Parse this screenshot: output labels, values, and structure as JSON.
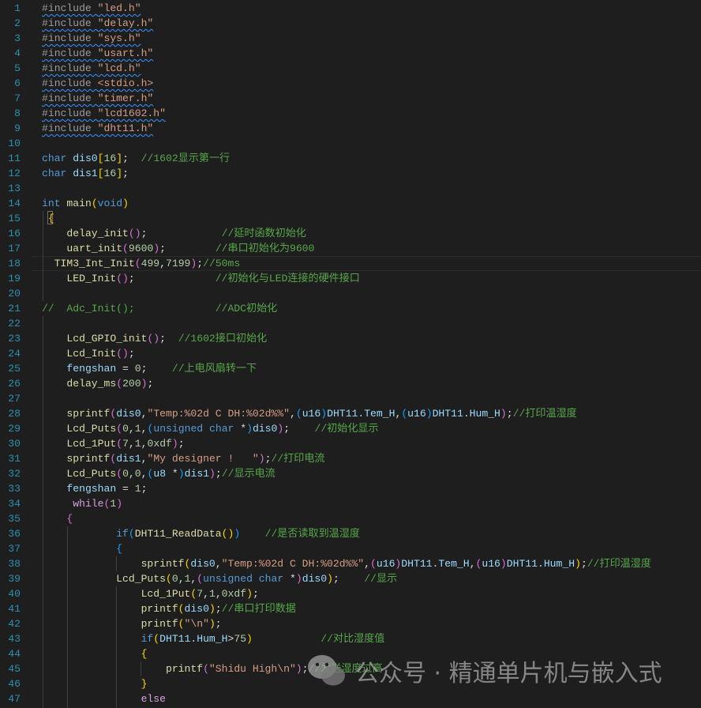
{
  "editor": {
    "lines": [
      {
        "n": "1",
        "sq": true,
        "tokens": [
          [
            "p",
            "#include "
          ],
          [
            "s",
            "\"led.h\""
          ]
        ]
      },
      {
        "n": "2",
        "sq": true,
        "tokens": [
          [
            "p",
            "#include "
          ],
          [
            "s",
            "\"delay.h\""
          ]
        ]
      },
      {
        "n": "3",
        "sq": true,
        "tokens": [
          [
            "p",
            "#include "
          ],
          [
            "s",
            "\"sys.h\""
          ]
        ]
      },
      {
        "n": "4",
        "sq": true,
        "tokens": [
          [
            "p",
            "#include "
          ],
          [
            "s",
            "\"usart.h\""
          ]
        ]
      },
      {
        "n": "5",
        "sq": true,
        "tokens": [
          [
            "p",
            "#include "
          ],
          [
            "s",
            "\"lcd.h\""
          ]
        ]
      },
      {
        "n": "6",
        "sq": true,
        "tokens": [
          [
            "p",
            "#include "
          ],
          [
            "s",
            "<stdio.h>"
          ]
        ]
      },
      {
        "n": "7",
        "sq": true,
        "tokens": [
          [
            "p",
            "#include "
          ],
          [
            "s",
            "\"timer.h\""
          ]
        ]
      },
      {
        "n": "8",
        "sq": true,
        "tokens": [
          [
            "p",
            "#include "
          ],
          [
            "s",
            "\"lcd1602.h\""
          ]
        ]
      },
      {
        "n": "9",
        "sq": true,
        "tokens": [
          [
            "p",
            "#include "
          ],
          [
            "s",
            "\"dht11.h\""
          ]
        ]
      },
      {
        "n": "10",
        "tokens": []
      },
      {
        "n": "11",
        "tokens": [
          [
            "k",
            "char"
          ],
          [
            "t",
            " "
          ],
          [
            "v",
            "dis0"
          ],
          [
            "b1",
            "["
          ],
          [
            "n",
            "16"
          ],
          [
            "b1",
            "]"
          ],
          [
            "t",
            ";  "
          ],
          [
            "m",
            "//1602显示第一行"
          ]
        ]
      },
      {
        "n": "12",
        "tokens": [
          [
            "k",
            "char"
          ],
          [
            "t",
            " "
          ],
          [
            "v",
            "dis1"
          ],
          [
            "b1",
            "["
          ],
          [
            "n",
            "16"
          ],
          [
            "b1",
            "]"
          ],
          [
            "t",
            ";"
          ]
        ]
      },
      {
        "n": "13",
        "tokens": []
      },
      {
        "n": "14",
        "tokens": [
          [
            "k",
            "int"
          ],
          [
            "t",
            " "
          ],
          [
            "f",
            "main"
          ],
          [
            "b1",
            "("
          ],
          [
            "k",
            "void"
          ],
          [
            "b1",
            ")"
          ]
        ]
      },
      {
        "n": "15",
        "tokens": [
          [
            "t",
            " "
          ],
          [
            "b1",
            "{"
          ]
        ]
      },
      {
        "n": "16",
        "tokens": [
          [
            "t",
            "    "
          ],
          [
            "f",
            "delay_init"
          ],
          [
            "b2",
            "()"
          ],
          [
            "t",
            ";            "
          ],
          [
            "m",
            "//延时函数初始化"
          ]
        ]
      },
      {
        "n": "17",
        "tokens": [
          [
            "t",
            "    "
          ],
          [
            "f",
            "uart_init"
          ],
          [
            "b2",
            "("
          ],
          [
            "n",
            "9600"
          ],
          [
            "b2",
            ")"
          ],
          [
            "t",
            ";        "
          ],
          [
            "m",
            "//串口初始化为9600"
          ]
        ]
      },
      {
        "n": "18",
        "tokens": [
          [
            "t",
            "  "
          ],
          [
            "f",
            "TIM3_Int_Init"
          ],
          [
            "b2",
            "("
          ],
          [
            "n",
            "499"
          ],
          [
            "t",
            ","
          ],
          [
            "n",
            "7199"
          ],
          [
            "b2",
            ")"
          ],
          [
            "t",
            ";"
          ],
          [
            "m",
            "//50ms"
          ]
        ]
      },
      {
        "n": "19",
        "tokens": [
          [
            "t",
            "    "
          ],
          [
            "f",
            "LED_Init"
          ],
          [
            "b2",
            "()"
          ],
          [
            "t",
            ";             "
          ],
          [
            "m",
            "//初始化与LED连接的硬件接口"
          ]
        ]
      },
      {
        "n": "20",
        "tokens": []
      },
      {
        "n": "21",
        "tokens": [
          [
            "m",
            "//  Adc_Init();             //ADC初始化"
          ]
        ]
      },
      {
        "n": "22",
        "tokens": []
      },
      {
        "n": "23",
        "tokens": [
          [
            "t",
            "    "
          ],
          [
            "f",
            "Lcd_GPIO_init"
          ],
          [
            "b2",
            "()"
          ],
          [
            "t",
            ";  "
          ],
          [
            "m",
            "//1602接口初始化"
          ]
        ]
      },
      {
        "n": "24",
        "tokens": [
          [
            "t",
            "    "
          ],
          [
            "f",
            "Lcd_Init"
          ],
          [
            "b2",
            "()"
          ],
          [
            "t",
            ";"
          ]
        ]
      },
      {
        "n": "25",
        "tokens": [
          [
            "t",
            "    "
          ],
          [
            "v",
            "fengshan"
          ],
          [
            "t",
            " = "
          ],
          [
            "n",
            "0"
          ],
          [
            "t",
            ";    "
          ],
          [
            "m",
            "//上电风扇转一下"
          ]
        ]
      },
      {
        "n": "26",
        "tokens": [
          [
            "t",
            "    "
          ],
          [
            "f",
            "delay_ms"
          ],
          [
            "b2",
            "("
          ],
          [
            "n",
            "200"
          ],
          [
            "b2",
            ")"
          ],
          [
            "t",
            ";"
          ]
        ]
      },
      {
        "n": "27",
        "tokens": []
      },
      {
        "n": "28",
        "tokens": [
          [
            "t",
            "    "
          ],
          [
            "f",
            "sprintf"
          ],
          [
            "b2",
            "("
          ],
          [
            "v",
            "dis0"
          ],
          [
            "t",
            ","
          ],
          [
            "s",
            "\"Temp:%02d C DH:%02d%%\""
          ],
          [
            "t",
            ","
          ],
          [
            "b3",
            "("
          ],
          [
            "v",
            "u16"
          ],
          [
            "b3",
            ")"
          ],
          [
            "v",
            "DHT11.Tem_H"
          ],
          [
            "t",
            ","
          ],
          [
            "b3",
            "("
          ],
          [
            "v",
            "u16"
          ],
          [
            "b3",
            ")"
          ],
          [
            "v",
            "DHT11.Hum_H"
          ],
          [
            "b2",
            ")"
          ],
          [
            "t",
            ";"
          ],
          [
            "m",
            "//打印温湿度"
          ]
        ]
      },
      {
        "n": "29",
        "tokens": [
          [
            "t",
            "    "
          ],
          [
            "f",
            "Lcd_Puts"
          ],
          [
            "b2",
            "("
          ],
          [
            "n",
            "0"
          ],
          [
            "t",
            ","
          ],
          [
            "n",
            "1"
          ],
          [
            "t",
            ","
          ],
          [
            "b3",
            "("
          ],
          [
            "k",
            "unsigned char"
          ],
          [
            "t",
            " *"
          ],
          [
            "b3",
            ")"
          ],
          [
            "v",
            "dis0"
          ],
          [
            "b2",
            ")"
          ],
          [
            "t",
            ";    "
          ],
          [
            "m",
            "//初始化显示"
          ]
        ]
      },
      {
        "n": "30",
        "tokens": [
          [
            "t",
            "    "
          ],
          [
            "f",
            "Lcd_1Put"
          ],
          [
            "b2",
            "("
          ],
          [
            "n",
            "7"
          ],
          [
            "t",
            ","
          ],
          [
            "n",
            "1"
          ],
          [
            "t",
            ","
          ],
          [
            "n",
            "0xdf"
          ],
          [
            "b2",
            ")"
          ],
          [
            "t",
            ";"
          ]
        ]
      },
      {
        "n": "31",
        "tokens": [
          [
            "t",
            "    "
          ],
          [
            "f",
            "sprintf"
          ],
          [
            "b2",
            "("
          ],
          [
            "v",
            "dis1"
          ],
          [
            "t",
            ","
          ],
          [
            "s",
            "\"My designer !   \""
          ],
          [
            "b2",
            ")"
          ],
          [
            "t",
            ";"
          ],
          [
            "m",
            "//打印电流"
          ]
        ]
      },
      {
        "n": "32",
        "tokens": [
          [
            "t",
            "    "
          ],
          [
            "f",
            "Lcd_Puts"
          ],
          [
            "b2",
            "("
          ],
          [
            "n",
            "0"
          ],
          [
            "t",
            ","
          ],
          [
            "n",
            "0"
          ],
          [
            "t",
            ","
          ],
          [
            "b3",
            "("
          ],
          [
            "v",
            "u8"
          ],
          [
            "t",
            " *"
          ],
          [
            "b3",
            ")"
          ],
          [
            "v",
            "dis1"
          ],
          [
            "b2",
            ")"
          ],
          [
            "t",
            ";"
          ],
          [
            "m",
            "//显示电流"
          ]
        ]
      },
      {
        "n": "33",
        "tokens": [
          [
            "t",
            "    "
          ],
          [
            "v",
            "fengshan"
          ],
          [
            "t",
            " = "
          ],
          [
            "n",
            "1"
          ],
          [
            "t",
            ";"
          ]
        ]
      },
      {
        "n": "34",
        "tokens": [
          [
            "t",
            "     "
          ],
          [
            "c",
            "while"
          ],
          [
            "b2",
            "("
          ],
          [
            "n",
            "1"
          ],
          [
            "b2",
            ")"
          ]
        ]
      },
      {
        "n": "35",
        "tokens": [
          [
            "t",
            "    "
          ],
          [
            "b2",
            "{"
          ]
        ]
      },
      {
        "n": "36",
        "tokens": [
          [
            "t",
            "            "
          ],
          [
            "k",
            "if"
          ],
          [
            "b3",
            "("
          ],
          [
            "f",
            "DHT11_ReadData"
          ],
          [
            "b1",
            "()"
          ],
          [
            "b3",
            ")"
          ],
          [
            "t",
            "    "
          ],
          [
            "m",
            "//是否读取到温湿度"
          ]
        ]
      },
      {
        "n": "37",
        "tokens": [
          [
            "t",
            "            "
          ],
          [
            "b3",
            "{"
          ]
        ]
      },
      {
        "n": "38",
        "tokens": [
          [
            "t",
            "                "
          ],
          [
            "f",
            "sprintf"
          ],
          [
            "b1",
            "("
          ],
          [
            "v",
            "dis0"
          ],
          [
            "t",
            ","
          ],
          [
            "s",
            "\"Temp:%02d C DH:%02d%%\""
          ],
          [
            "t",
            ","
          ],
          [
            "b2",
            "("
          ],
          [
            "v",
            "u16"
          ],
          [
            "b2",
            ")"
          ],
          [
            "v",
            "DHT11.Tem_H"
          ],
          [
            "t",
            ","
          ],
          [
            "b2",
            "("
          ],
          [
            "v",
            "u16"
          ],
          [
            "b2",
            ")"
          ],
          [
            "v",
            "DHT11.Hum_H"
          ],
          [
            "b1",
            ")"
          ],
          [
            "t",
            ";"
          ],
          [
            "m",
            "//打印温湿度"
          ]
        ]
      },
      {
        "n": "39",
        "tokens": [
          [
            "t",
            "            "
          ],
          [
            "f",
            "Lcd_Puts"
          ],
          [
            "b1",
            "("
          ],
          [
            "n",
            "0"
          ],
          [
            "t",
            ","
          ],
          [
            "n",
            "1"
          ],
          [
            "t",
            ","
          ],
          [
            "b2",
            "("
          ],
          [
            "k",
            "unsigned char"
          ],
          [
            "t",
            " *"
          ],
          [
            "b2",
            ")"
          ],
          [
            "v",
            "dis0"
          ],
          [
            "b1",
            ")"
          ],
          [
            "t",
            ";    "
          ],
          [
            "m",
            "//显示"
          ]
        ]
      },
      {
        "n": "40",
        "tokens": [
          [
            "t",
            "                "
          ],
          [
            "f",
            "Lcd_1Put"
          ],
          [
            "b1",
            "("
          ],
          [
            "n",
            "7"
          ],
          [
            "t",
            ","
          ],
          [
            "n",
            "1"
          ],
          [
            "t",
            ","
          ],
          [
            "n",
            "0xdf"
          ],
          [
            "b1",
            ")"
          ],
          [
            "t",
            ";"
          ]
        ]
      },
      {
        "n": "41",
        "tokens": [
          [
            "t",
            "                "
          ],
          [
            "f",
            "printf"
          ],
          [
            "b1",
            "("
          ],
          [
            "v",
            "dis0"
          ],
          [
            "b1",
            ")"
          ],
          [
            "t",
            ";"
          ],
          [
            "m",
            "//串口打印数据"
          ]
        ]
      },
      {
        "n": "42",
        "tokens": [
          [
            "t",
            "                "
          ],
          [
            "f",
            "printf"
          ],
          [
            "b1",
            "("
          ],
          [
            "s",
            "\"\\n\""
          ],
          [
            "b1",
            ")"
          ],
          [
            "t",
            ";"
          ]
        ]
      },
      {
        "n": "43",
        "tokens": [
          [
            "t",
            "                "
          ],
          [
            "k",
            "if"
          ],
          [
            "b1",
            "("
          ],
          [
            "v",
            "DHT11.Hum_H"
          ],
          [
            "t",
            ">"
          ],
          [
            "n",
            "75"
          ],
          [
            "b1",
            ")"
          ],
          [
            "t",
            "           "
          ],
          [
            "m",
            "//对比湿度值"
          ]
        ]
      },
      {
        "n": "44",
        "tokens": [
          [
            "t",
            "                "
          ],
          [
            "b1",
            "{"
          ]
        ]
      },
      {
        "n": "45",
        "tokens": [
          [
            "t",
            "                    "
          ],
          [
            "f",
            "printf"
          ],
          [
            "b2",
            "("
          ],
          [
            "s",
            "\"Shidu High\\n\""
          ],
          [
            "b2",
            ")"
          ],
          [
            "t",
            ";"
          ],
          [
            "m",
            "//发送湿度过高"
          ]
        ]
      },
      {
        "n": "46",
        "tokens": [
          [
            "t",
            "                "
          ],
          [
            "b1",
            "}"
          ]
        ]
      },
      {
        "n": "47",
        "tokens": [
          [
            "t",
            "                "
          ],
          [
            "c",
            "else"
          ]
        ]
      }
    ]
  },
  "watermark": {
    "text": "公众号 · 精通单片机与嵌入式",
    "icon": "wechat-icon"
  },
  "colors": {
    "background": "#1e1e1e",
    "line_numbers": "#2b91af",
    "comment": "#57a64a",
    "keyword": "#569cd6",
    "string": "#d69d85"
  }
}
